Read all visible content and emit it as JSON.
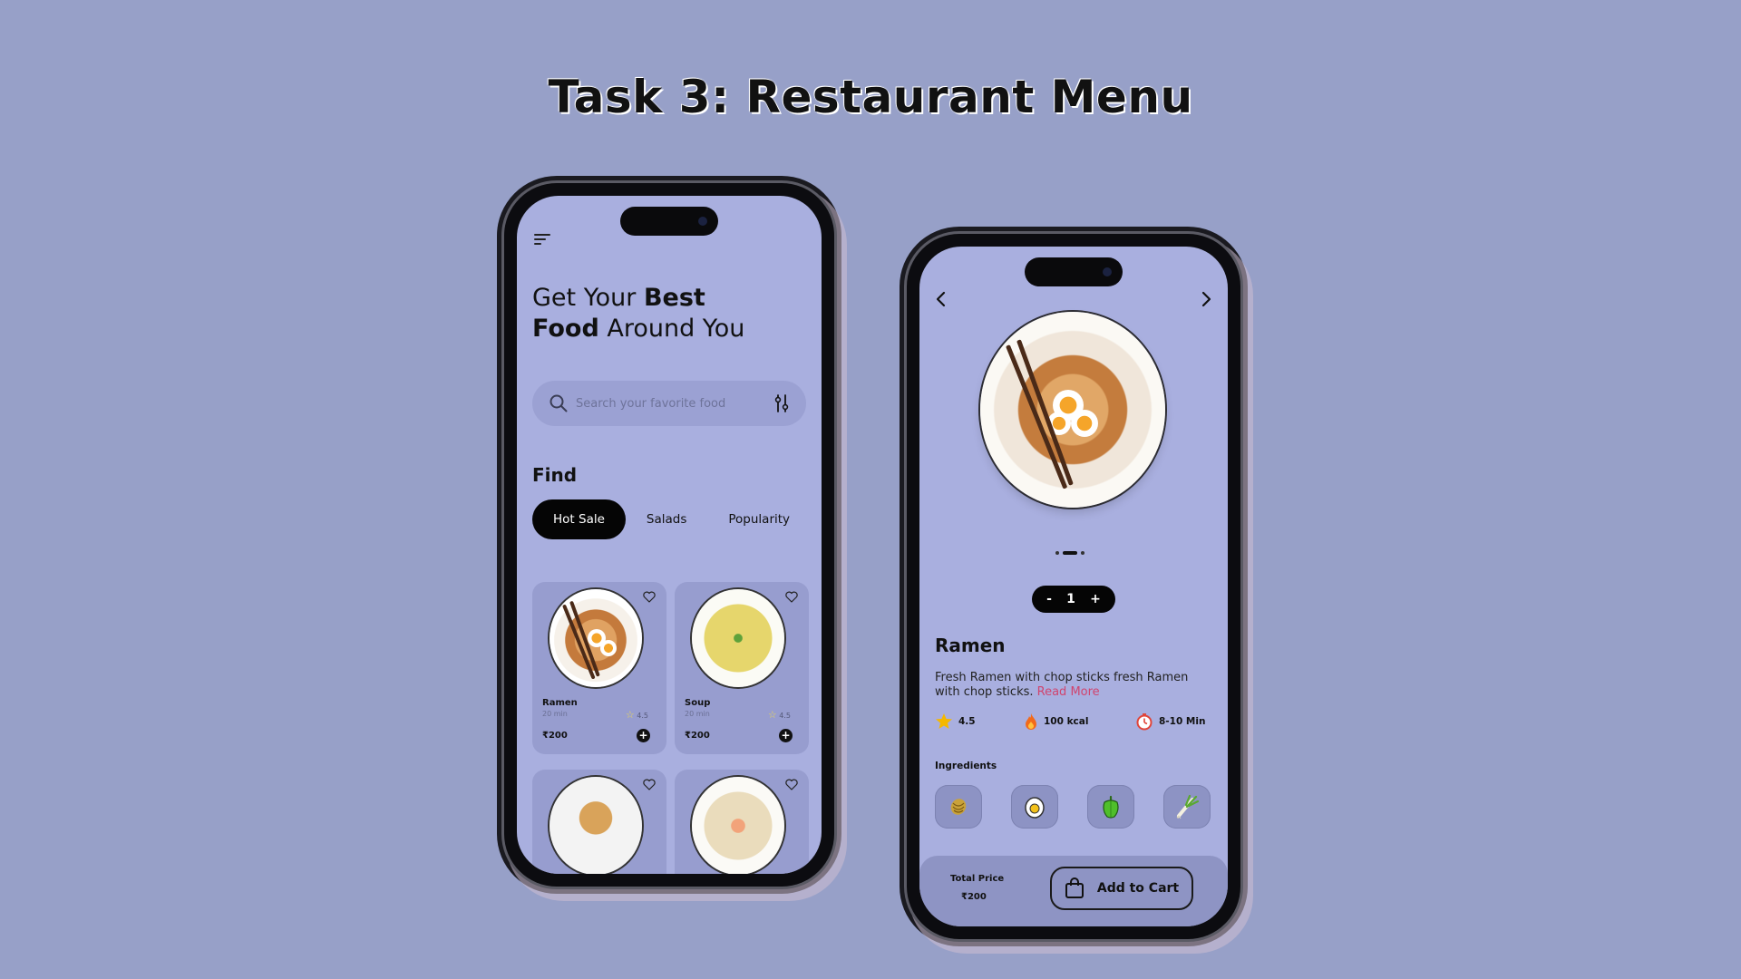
{
  "page": {
    "title": "Task 3: Restaurant Menu"
  },
  "home": {
    "heading": {
      "line1_normal": "Get Your ",
      "line1_bold": "Best",
      "line2_bold": "Food",
      "line2_normal": " Around You"
    },
    "search": {
      "placeholder": "Search your favorite food"
    },
    "find_label": "Find",
    "tabs": [
      {
        "label": "Hot Sale",
        "active": true
      },
      {
        "label": "Salads",
        "active": false
      },
      {
        "label": "Popularity",
        "active": false
      }
    ],
    "items": [
      {
        "name": "Ramen",
        "time": "20 min",
        "rating": "4.5",
        "price": "₹200"
      },
      {
        "name": "Soup",
        "time": "20 min",
        "rating": "4.5",
        "price": "₹200"
      }
    ]
  },
  "detail": {
    "carousel": {
      "count": 3,
      "active": 2
    },
    "quantity": {
      "minus": "-",
      "value": "1",
      "plus": "+"
    },
    "name": "Ramen",
    "description": "Fresh Ramen with chop sticks fresh Ramen with chop sticks. ",
    "read_more": "Read More",
    "stats": {
      "rating": "4.5",
      "calories": "100 kcal",
      "time": "8-10 Min"
    },
    "ingredients_label": "Ingredients",
    "ingredients": [
      "noodles-icon",
      "egg-icon",
      "pepper-icon",
      "scallion-icon"
    ],
    "total_label": "Total Price",
    "total_value": "₹200",
    "cart_label": "Add to Cart"
  },
  "colors": {
    "background": "#97a0c8",
    "screen": "#a9afdf",
    "accent_link": "#d0446e",
    "button_dark": "#050505"
  }
}
